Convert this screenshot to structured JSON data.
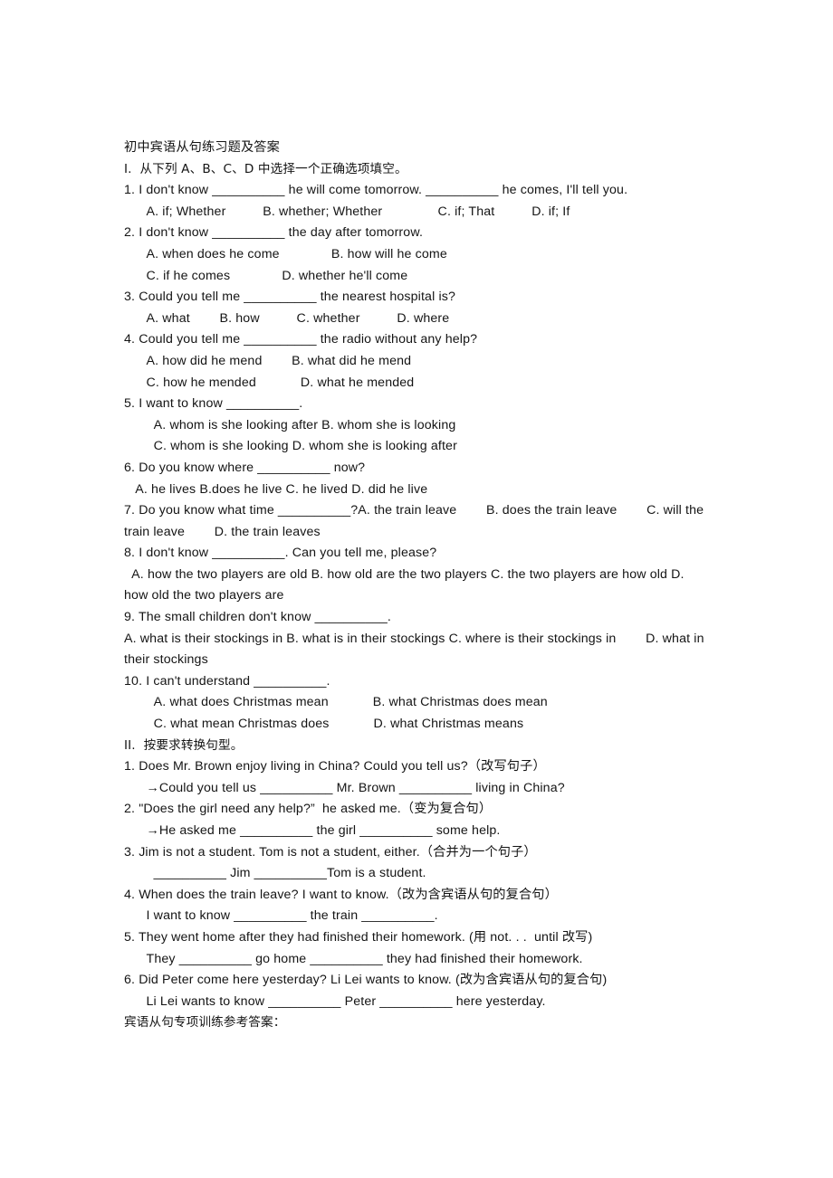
{
  "document": {
    "title": "初中宾语从句练习题及答案",
    "blank": "__________",
    "arrow": "→",
    "sections": [
      {
        "heading": "I.  从下列 A、B、C、D 中选择一个正确选项填空。",
        "items": [
          {
            "stem": "1. I don't know __________ he will come tomorrow. __________ he comes, I'll tell you.",
            "options": [
              "      A. if; Whether          B. whether; Whether               C. if; That          D. if; If"
            ]
          },
          {
            "stem": "2. I don't know __________ the day after tomorrow.",
            "options": [
              "      A. when does he come              B. how will he come",
              "      C. if he comes              D. whether he'll come"
            ]
          },
          {
            "stem": "3. Could you tell me __________ the nearest hospital is?",
            "options": [
              "      A. what        B. how          C. whether          D. where"
            ]
          },
          {
            "stem": "4. Could you tell me __________ the radio without any help?",
            "options": [
              "      A. how did he mend        B. what did he mend",
              "      C. how he mended            D. what he mended"
            ]
          },
          {
            "stem": "5. I want to know __________.",
            "options": [
              "        A. whom is she looking after B. whom she is looking",
              "        C. whom is she looking D. whom she is looking after"
            ]
          },
          {
            "stem": "6. Do you know where __________ now?",
            "options": [
              "   A. he lives B.does he live C. he lived D. did he live"
            ]
          },
          {
            "stem": "7. Do you know what time __________?A. the train leave        B. does the train leave        C. will the train leave        D. the train leaves",
            "options": []
          },
          {
            "stem": "8. I don't know __________. Can you tell me, please?",
            "options": [
              "  A. how the two players are old B. how old are the two players C. the two players are how old D. how old the two players are"
            ]
          },
          {
            "stem": "9. The small children don't know __________.",
            "options": [
              "A. what is their stockings in B. what is in their stockings C. where is their stockings in        D. what in their stockings"
            ]
          },
          {
            "stem": "10. I can't understand __________.",
            "options": [
              "        A. what does Christmas mean            B. what Christmas does mean",
              "        C. what mean Christmas does            D. what Christmas means"
            ]
          }
        ]
      },
      {
        "heading": "II.  按要求转换句型。",
        "items": [
          {
            "stem": "1. Does Mr. Brown enjoy living in China? Could you tell us?（改写句子）",
            "options": [
              "      →Could you tell us __________ Mr. Brown __________ living in China?"
            ]
          },
          {
            "stem": "2. \"Does the girl need any help?”  he asked me.（变为复合句）",
            "options": [
              "      →He asked me __________ the girl __________ some help."
            ]
          },
          {
            "stem": "3. Jim is not a student. Tom is not a student, either.（合并为一个句子）",
            "options": [
              "        __________ Jim __________Tom is a student."
            ]
          },
          {
            "stem": "4. When does the train leave? I want to know.（改为含宾语从句的复合句）",
            "options": [
              "      I want to know __________ the train __________."
            ]
          },
          {
            "stem": "5. They went home after they had finished their homework. (用 not. . .  until 改写)",
            "options": [
              "      They __________ go home __________ they had finished their homework."
            ]
          },
          {
            "stem": "6. Did Peter come here yesterday? Li Lei wants to know. (改为含宾语从句的复合句)",
            "options": [
              "      Li Lei wants to know __________ Peter __________ here yesterday."
            ]
          }
        ]
      }
    ],
    "footer": "宾语从句专项训练参考答案："
  }
}
